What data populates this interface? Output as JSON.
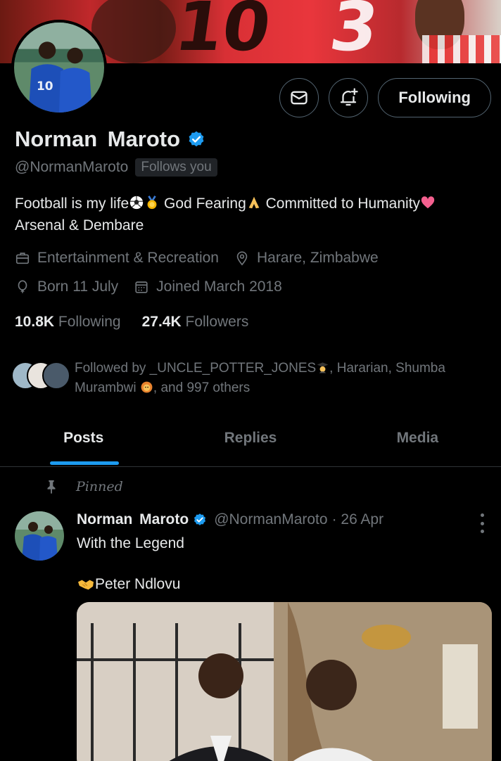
{
  "profile": {
    "name": "Norman  Maroto",
    "handle": "@NormanMaroto",
    "follows_you": "Follows you",
    "bio_line1_a": "Football is my life",
    "bio_line1_b": " God Fearing",
    "bio_line1_c": " Committed to Humanity",
    "bio_line2": "Arsenal & Dembare",
    "category": "Entertainment & Recreation",
    "location": "Harare, Zimbabwe",
    "birthday": "Born 11 July",
    "joined": "Joined March 2018",
    "following_count": "10.8K",
    "following_label": "Following",
    "followers_count": "27.4K",
    "followers_label": "Followers",
    "followed_by_a": "Followed by _UNCLE_POTTER_JONES",
    "followed_by_b": ", Hararian, Shumba Murambwi ",
    "followed_by_c": ", and 997 others"
  },
  "actions": {
    "following_button": "Following"
  },
  "tabs": [
    {
      "label": "Posts",
      "active": true
    },
    {
      "label": "Replies",
      "active": false
    },
    {
      "label": "Media",
      "active": false
    }
  ],
  "post": {
    "pinned_label": "Pinned",
    "author_name": "Norman  Maroto",
    "author_handle": "@NormanMaroto",
    "date": "· 26 Apr",
    "text_line1": "With the Legend",
    "text_line2": "Peter Ndlovu"
  },
  "colors": {
    "accent": "#1d9bf0",
    "muted": "#71767b",
    "text": "#e7e9ea",
    "background": "#000000",
    "border": "#2f3336"
  },
  "icons": [
    "envelope-icon",
    "bell-plus-icon",
    "verified-badge-icon",
    "briefcase-icon",
    "location-pin-icon",
    "balloon-icon",
    "calendar-icon",
    "pin-icon",
    "more-vertical-icon"
  ]
}
